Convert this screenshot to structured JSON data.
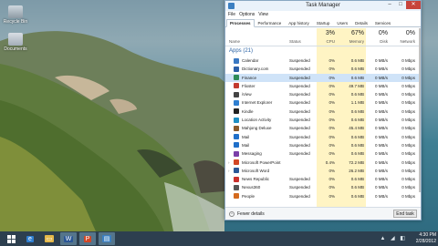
{
  "desktop": {
    "icons": [
      {
        "label": "Recycle Bin"
      },
      {
        "label": "Documents"
      }
    ]
  },
  "task_manager": {
    "title": "Task Manager",
    "win_buttons": {
      "minimize": "–",
      "maximize": "□",
      "close": "✕"
    },
    "menu": [
      "File",
      "Options",
      "View"
    ],
    "tabs": [
      "Processes",
      "Performance",
      "App history",
      "Startup",
      "Users",
      "Details",
      "Services"
    ],
    "active_tab": "Processes",
    "headers": {
      "name": "Name",
      "status": "Status",
      "cpu_pct": "3%",
      "cpu": "CPU",
      "mem_pct": "67%",
      "mem": "Memory",
      "disk_pct": "0%",
      "disk": "Disk",
      "net_pct": "0%",
      "net": "Network"
    },
    "group_label": "Apps (21)",
    "rows": [
      {
        "name": "Calendar",
        "status": "Suspended",
        "cpu": "0%",
        "mem": "0.6 MB",
        "disk": "0 MB/s",
        "net": "0 Mbps",
        "color": "#3a78c2"
      },
      {
        "name": "Dictionary.com",
        "status": "Suspended",
        "cpu": "0%",
        "mem": "0.6 MB",
        "disk": "0 MB/s",
        "net": "0 Mbps",
        "color": "#2b5fa8"
      },
      {
        "name": "Finance",
        "status": "Suspended",
        "cpu": "0%",
        "mem": "0.6 MB",
        "disk": "0 MB/s",
        "net": "0 Mbps",
        "color": "#2e8b57"
      },
      {
        "name": "Flixster",
        "status": "Suspended",
        "cpu": "0%",
        "mem": "49.7 MB",
        "disk": "0 MB/s",
        "net": "0 Mbps",
        "color": "#c33a2f"
      },
      {
        "name": "iView",
        "status": "Suspended",
        "cpu": "0%",
        "mem": "0.6 MB",
        "disk": "0 MB/s",
        "net": "0 Mbps",
        "color": "#444444"
      },
      {
        "name": "Internet Explorer",
        "status": "Suspended",
        "cpu": "0%",
        "mem": "1.1 MB",
        "disk": "0 MB/s",
        "net": "0 Mbps",
        "color": "#2f7fd1"
      },
      {
        "name": "Kindle",
        "status": "Suspended",
        "cpu": "0%",
        "mem": "0.6 MB",
        "disk": "0 MB/s",
        "net": "0 Mbps",
        "color": "#222222"
      },
      {
        "name": "Location Activity",
        "status": "Suspended",
        "cpu": "0%",
        "mem": "0.6 MB",
        "disk": "0 MB/s",
        "net": "0 Mbps",
        "color": "#1e8fc4"
      },
      {
        "name": "Mahjong Deluxe",
        "status": "Suspended",
        "cpu": "0%",
        "mem": "45.4 MB",
        "disk": "0 MB/s",
        "net": "0 Mbps",
        "color": "#8a5a2b"
      },
      {
        "name": "Mail",
        "status": "Suspended",
        "cpu": "0%",
        "mem": "0.6 MB",
        "disk": "0 MB/s",
        "net": "0 Mbps",
        "color": "#1f6fc9"
      },
      {
        "name": "Mail",
        "status": "Suspended",
        "cpu": "0%",
        "mem": "0.6 MB",
        "disk": "0 MB/s",
        "net": "0 Mbps",
        "color": "#1f6fc9"
      },
      {
        "name": "Messaging",
        "status": "Suspended",
        "cpu": "0%",
        "mem": "0.6 MB",
        "disk": "0 MB/s",
        "net": "0 Mbps",
        "color": "#7b3fa8"
      },
      {
        "name": "Microsoft PowerPoint",
        "status": "",
        "cpu": "0.4%",
        "mem": "72.2 MB",
        "disk": "0 MB/s",
        "net": "0 Mbps",
        "color": "#d24726",
        "expand": "›"
      },
      {
        "name": "Microsoft Word",
        "status": "",
        "cpu": "0%",
        "mem": "26.2 MB",
        "disk": "0 MB/s",
        "net": "0 Mbps",
        "color": "#2b5797",
        "expand": "›"
      },
      {
        "name": "News Republic",
        "status": "Suspended",
        "cpu": "0%",
        "mem": "0.6 MB",
        "disk": "0 MB/s",
        "net": "0 Mbps",
        "color": "#c9302c"
      },
      {
        "name": "Nexus360",
        "status": "Suspended",
        "cpu": "0%",
        "mem": "0.6 MB",
        "disk": "0 MB/s",
        "net": "0 Mbps",
        "color": "#555555"
      },
      {
        "name": "People",
        "status": "Suspended",
        "cpu": "0%",
        "mem": "0.6 MB",
        "disk": "0 MB/s",
        "net": "0 Mbps",
        "color": "#d46a1e"
      }
    ],
    "footer": {
      "fewer_details": "Fewer details",
      "end_task": "End task"
    }
  },
  "taskbar": {
    "apps": [
      {
        "icon": "ie-icon",
        "glyph": "e",
        "color": "#2f7fd1"
      },
      {
        "icon": "explorer-icon",
        "glyph": "▭",
        "color": "#e4b849"
      },
      {
        "icon": "word-icon",
        "glyph": "W",
        "color": "#2b5797"
      },
      {
        "icon": "powerpoint-icon",
        "glyph": "P",
        "color": "#d24726"
      },
      {
        "icon": "task-manager-icon",
        "glyph": "▤",
        "color": "#3c7fc1"
      }
    ],
    "time": "4:30 PM",
    "date": "2/28/2012"
  },
  "colors": {
    "accent": "#2a62a4",
    "selection": "#cfe3f8",
    "heat": "#fff4c4",
    "taskbar": "#2d3f4f"
  }
}
